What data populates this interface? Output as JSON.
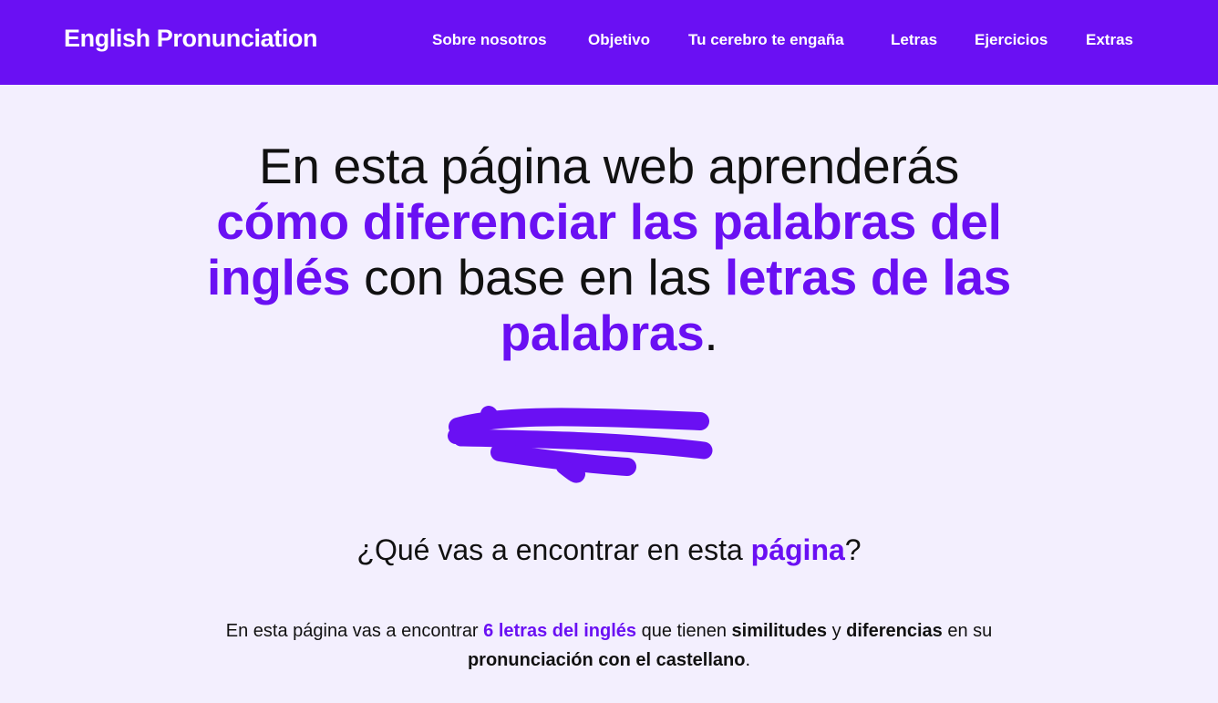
{
  "nav": {
    "brand": "English Pronunciation",
    "links": [
      "Sobre nosotros",
      "Objetivo",
      "Tu cerebro te engaña",
      "Letras",
      "Ejercicios",
      "Extras"
    ]
  },
  "hero": {
    "line1": "En esta página web aprenderás",
    "line2_accent": "cómo diferenciar las palabras del",
    "line3_accent_a": "inglés",
    "line3_plain": " con base en las ",
    "line3_accent_b": "letras de las",
    "line4_accent": "palabras",
    "line4_period": "."
  },
  "section": {
    "heading_plain_a": "¿Qué vas a encontrar en esta ",
    "heading_accent": "página",
    "heading_plain_b": "?",
    "p1_plain_a": "En esta página vas a encontrar ",
    "p1_accent": "6 letras del inglés",
    "p1_plain_b": " que tienen ",
    "p1_strong_a": "similitudes",
    "p1_plain_c": " y ",
    "p1_strong_b": "diferencias",
    "p1_plain_d": " en su",
    "p2_strong": "pronunciación con el castellano",
    "p2_period": "."
  },
  "colors": {
    "accent": "#6a10f3",
    "background": "#f3effe",
    "text": "#111111"
  }
}
